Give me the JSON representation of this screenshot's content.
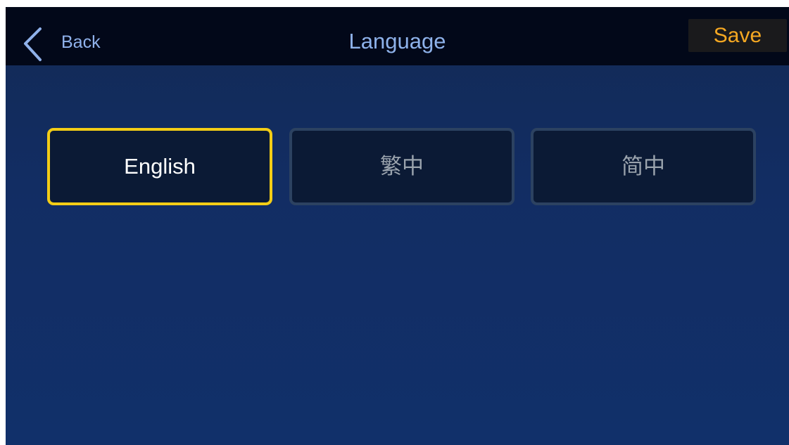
{
  "header": {
    "back_label": "Back",
    "title": "Language",
    "save_label": "Save",
    "back_icon": "chevron-left-icon"
  },
  "languages": {
    "options": [
      {
        "label": "English",
        "selected": true
      },
      {
        "label": "繁中",
        "selected": false
      },
      {
        "label": "简中",
        "selected": false
      }
    ]
  },
  "colors": {
    "background": "#122d63",
    "topbar": "#020819",
    "accent_title": "#8eb2ea",
    "save_text": "#f5a822",
    "selected_border": "#f3cd16",
    "option_border": "#2c4261",
    "option_fill": "#0b1a35"
  }
}
